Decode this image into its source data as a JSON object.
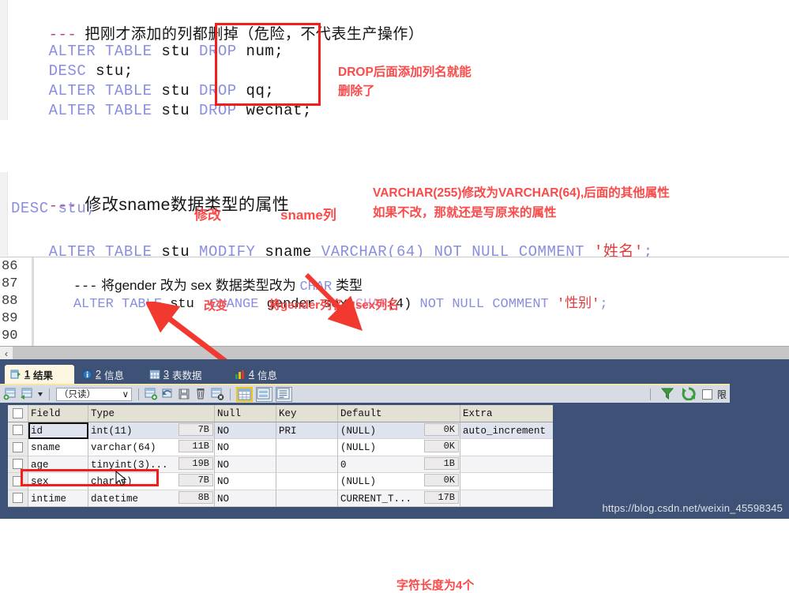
{
  "snippet_top": {
    "comment_dashes": "---",
    "comment_text": "把刚才添加的列都删掉（危险，不代表生产操作）",
    "lines": [
      {
        "kw1": "ALTER TABLE",
        "obj": " stu ",
        "kw2": "DROP",
        "tail": " num;"
      },
      {
        "kw1": "DESC",
        "obj": " stu;",
        "kw2": "",
        "tail": ""
      },
      {
        "kw1": "ALTER TABLE",
        "obj": " stu ",
        "kw2": "DROP",
        "tail": " qq;"
      },
      {
        "kw1": "ALTER TABLE",
        "obj": " stu ",
        "kw2": "DROP",
        "tail": " wechat;"
      }
    ],
    "annotation_line1": "DROP后面添加列名就能",
    "annotation_line2": "删除了"
  },
  "snippet_mid": {
    "comment_dashes": "---",
    "comment_text": "修改sname数据类型的属性",
    "line_desc": "DESC stu;",
    "alter_kw1": "ALTER TABLE",
    "alter_obj": " stu ",
    "alter_kw2": "MODIFY",
    "alter_col": " sname ",
    "alter_type": "VARCHAR(64)",
    "alter_kw3": " NOT NULL COMMENT ",
    "alter_str": "'姓名'",
    "alter_end": ";",
    "ann_modify": "修改",
    "ann_column": "sname列",
    "ann_right1": "VARCHAR(255)修改为VARCHAR(64),后面的其他属性",
    "ann_right2": "如果不改，那就还是写原来的属性"
  },
  "editor": {
    "line_numbers": [
      "86",
      "87",
      "88",
      "89",
      "90"
    ],
    "line86": {
      "dashes": "---",
      "text_a": " 将gender 改为 sex 数据类型改为 ",
      "kw": "CHAR",
      "text_b": " 类型"
    },
    "line87": {
      "kw1": "ALTER TABLE",
      "obj": " stu  ",
      "kw2": "CHANGE",
      "cols": " gender sex ",
      "type": "CHAR",
      "paren": "(4)",
      "kw3": " NOT NULL COMMENT ",
      "str": "'性别'",
      "end": ";"
    },
    "ann_change": "改变",
    "ann_rename": "将gender列名为sex列名",
    "ann_length": "字符长度为4个",
    "scroll_left_arrow": "‹"
  },
  "result_panel": {
    "tabs": [
      {
        "num": "1",
        "label": "结果",
        "icon": "result-grid-icon",
        "active": true
      },
      {
        "num": "2",
        "label": "信息",
        "icon": "info-icon",
        "active": false
      },
      {
        "num": "3",
        "label": "表数据",
        "icon": "table-data-icon",
        "active": false
      },
      {
        "num": "4",
        "label": "信息",
        "icon": "chart-info-icon",
        "active": false
      }
    ],
    "toolbar": {
      "readonly_label": "（只读）",
      "dropdown_caret": "∨",
      "buttons": [
        "add-record-icon",
        "insert-record-icon",
        "dropdown-caret-icon",
        "apply-changes-icon",
        "refresh-record-icon",
        "save-icon",
        "delete-icon",
        "cancel-icon"
      ],
      "view_buttons": [
        "grid-view-icon",
        "form-view-icon",
        "text-view-icon"
      ],
      "filter_icon": "filter-icon",
      "refresh_icon": "refresh-icon",
      "limit_label": "限"
    },
    "grid": {
      "columns": [
        "Field",
        "Type",
        "Null",
        "Key",
        "Default",
        "Extra"
      ],
      "rows": [
        {
          "field": "id",
          "type": "int(11)",
          "type_size": "7B",
          "null": "NO",
          "key": "PRI",
          "default": "(NULL)",
          "default_size": "0K",
          "extra": "auto_increment"
        },
        {
          "field": "sname",
          "type": "varchar(64)",
          "type_size": "11B",
          "null": "NO",
          "key": "",
          "default": "(NULL)",
          "default_size": "0K",
          "extra": ""
        },
        {
          "field": "age",
          "type": "tinyint(3)...",
          "type_size": "19B",
          "null": "NO",
          "key": "",
          "default": "0",
          "default_size": "1B",
          "extra": ""
        },
        {
          "field": "sex",
          "type": "char(4)",
          "type_size": "7B",
          "null": "NO",
          "key": "",
          "default": "(NULL)",
          "default_size": "0K",
          "extra": ""
        },
        {
          "field": "intime",
          "type": "datetime",
          "type_size": "8B",
          "null": "NO",
          "key": "",
          "default": "CURRENT_T...",
          "default_size": "17B",
          "extra": ""
        }
      ]
    }
  },
  "watermark": "https://blog.csdn.net/weixin_45598345",
  "colors": {
    "keyword": "#8a8ee0",
    "annotation_red": "#fb4a4a",
    "box_red": "#f51c1c",
    "panel_blue": "#3e5277",
    "active_tab": "#fdf7e2",
    "toolbar": "#d6dbe4",
    "grid_header": "#e3e0d4",
    "row_selected": "#dfe3ee"
  }
}
